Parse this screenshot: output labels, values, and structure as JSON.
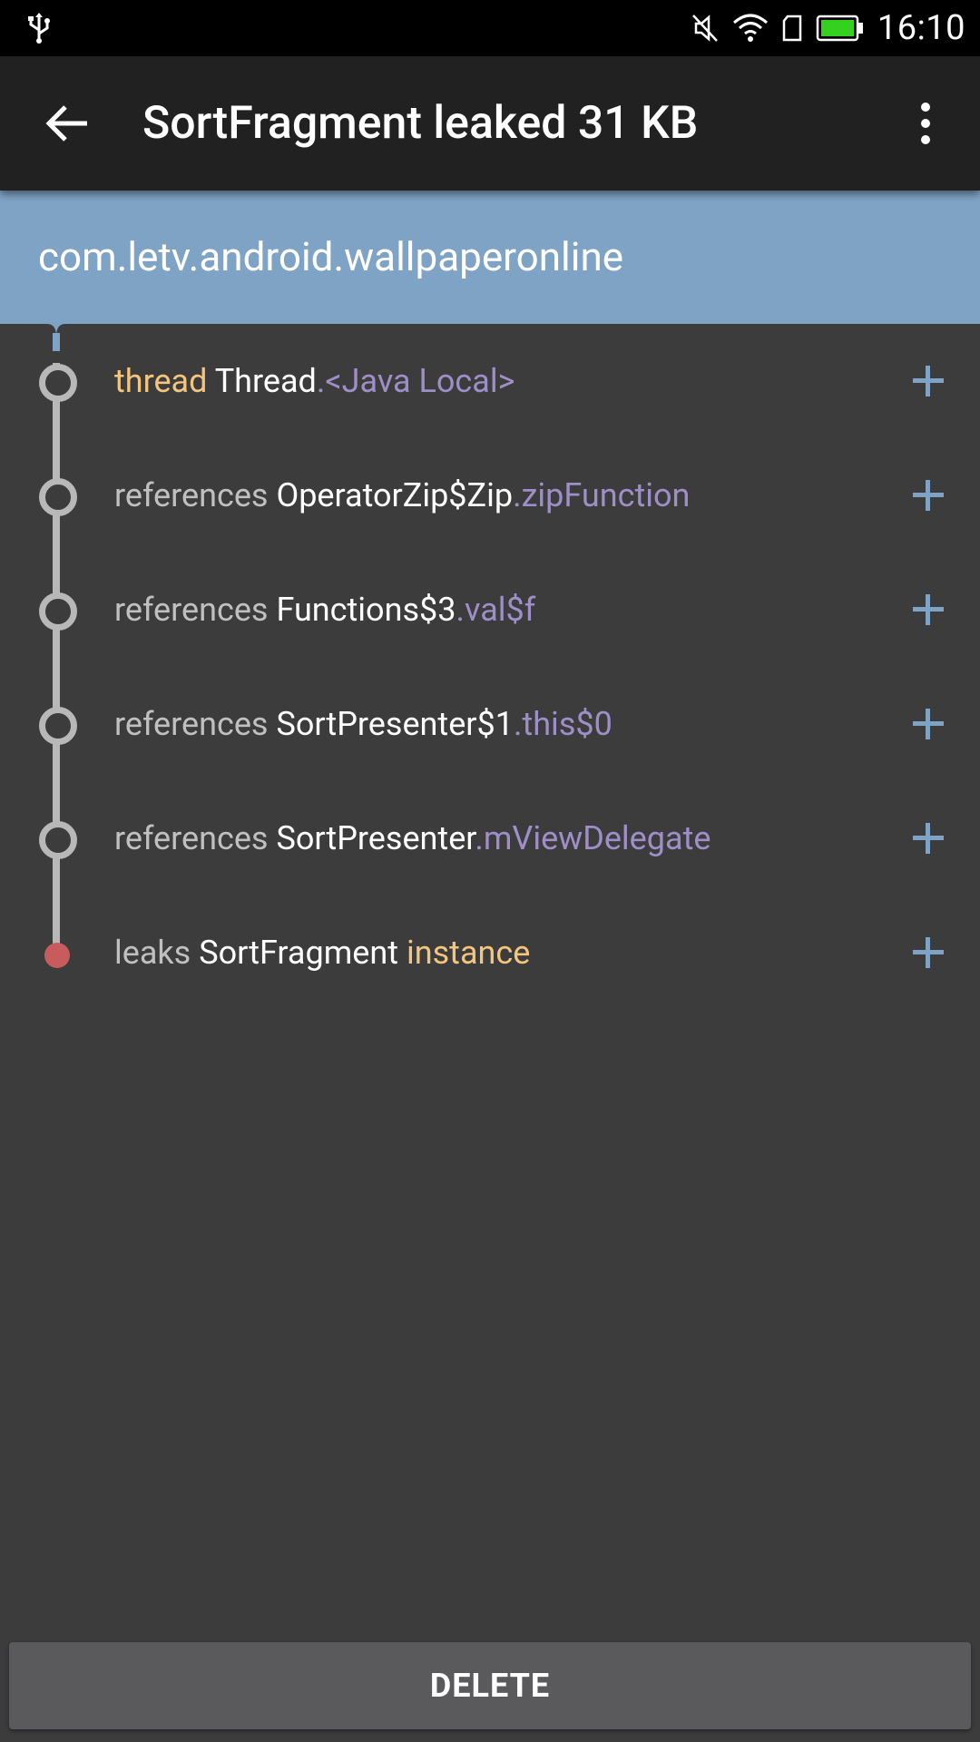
{
  "status_bar": {
    "time": "16:10",
    "icons": [
      "usb-icon",
      "mute-icon",
      "wifi-icon",
      "sim-icon",
      "battery-icon"
    ],
    "battery_color": "#34d21e"
  },
  "app_bar": {
    "title": "SortFragment leaked 31 KB",
    "back_icon": "arrow-back-icon",
    "menu_icon": "more-vert-icon"
  },
  "header": {
    "package": "com.letv.android.wallpaperonline",
    "color": "#7fa3c4"
  },
  "colors": {
    "keyword_gray": "#c0c0c0",
    "keyword_orange": "#f3c57f",
    "class_white": "#ffffff",
    "field_purple": "#9e8fc9",
    "leak_red": "#c85c5c",
    "plus_blue": "#7fa3c4"
  },
  "trace": [
    {
      "keyword": "thread",
      "class_name": "Thread",
      "dot": ".",
      "field": "<Java Local>"
    },
    {
      "keyword": "references",
      "class_name": "OperatorZip$Zip",
      "dot": ".",
      "field": "zipFunction"
    },
    {
      "keyword": "references",
      "class_name": "Functions$3",
      "dot": ".",
      "field": "val$f"
    },
    {
      "keyword": "references",
      "class_name": "SortPresenter$1",
      "dot": ".",
      "field": "this$0"
    },
    {
      "keyword": "references",
      "class_name": "SortPresenter",
      "dot": ".",
      "field": "mViewDelegate"
    },
    {
      "keyword": "leaks",
      "class_name": "SortFragment",
      "dot": "",
      "field": "instance"
    }
  ],
  "delete_label": "DELETE"
}
